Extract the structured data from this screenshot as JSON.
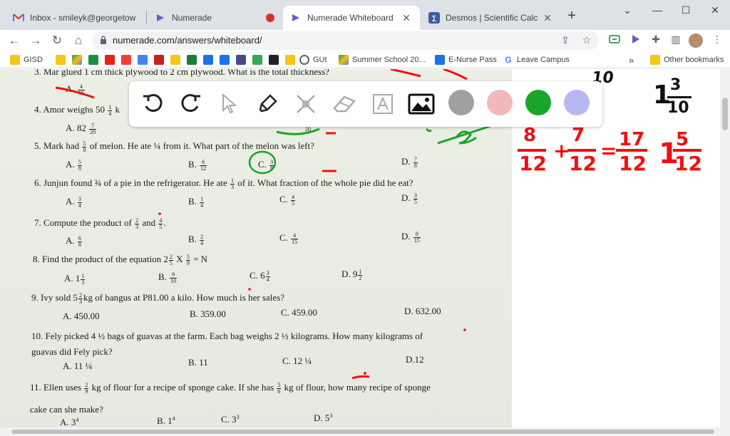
{
  "tabs": [
    {
      "title": "Inbox - smileyk@georgetow",
      "icon": "gmail-icon",
      "active": false
    },
    {
      "title": "Numerade",
      "icon": "numerade-icon",
      "active": false
    },
    {
      "title": "Numerade Whiteboard",
      "icon": "numerade-icon",
      "active": true
    },
    {
      "title": "Desmos | Scientific Calculat",
      "icon": "desmos-icon",
      "active": false
    }
  ],
  "address": {
    "url": "numerade.com/answers/whiteboard/"
  },
  "bookmarks": [
    {
      "label": "GISD",
      "icon": "folder-icon"
    },
    {
      "label": "GUt",
      "icon": "globe-icon"
    },
    {
      "label": "Summer School 20...",
      "icon": "drive-icon"
    },
    {
      "label": "E-Nurse Pass",
      "icon": "bookmark-icon"
    },
    {
      "label": "Leave Campus",
      "icon": "google-icon"
    },
    {
      "label": "Other bookmarks",
      "icon": "folder-icon"
    }
  ],
  "overflow_label": "»",
  "worksheet": {
    "q3": {
      "pre": "3. Mar glued 1",
      "mid": "cm thick plywood to 2",
      "post": "cm plywood. What is the total thickness?",
      "optA": "A.",
      "optA_n": "4",
      "optA_d": "16"
    },
    "q4": {
      "pre": "4. Amor weighs 50",
      "f_n": "1",
      "f_d": "4",
      "post": "k",
      "optA": "A.  82",
      "optA_n": "7",
      "optA_d": "20",
      "optC_d": "20"
    },
    "q5": {
      "pre": "5. Mark had",
      "f_n": "5",
      "f_d": "8",
      "post": "of melon. He ate ¼ from it. What part of the melon was left?",
      "a": "A.",
      "a_n": "5",
      "a_d": "8",
      "b": "B.",
      "b_n": "6",
      "b_d": "12",
      "c": "C.",
      "c_n": "3",
      "c_d": "8",
      "d": "D.",
      "d_n": "7",
      "d_d": "8"
    },
    "q6": {
      "pre": "6. Junjun found ¾ of a pie in the refrigerator. He ate",
      "f_n": "1",
      "f_d": "3",
      "post": "of it. What fraction of the whole pie did he eat?",
      "a": "A.",
      "a_n": "3",
      "a_d": "4",
      "b": "B.",
      "b_n": "1",
      "b_d": "4",
      "c": "C.",
      "c_n": "4",
      "c_d": "5",
      "d": "D.",
      "d_n": "3",
      "d_d": "5"
    },
    "q7": {
      "pre": "7. Compute the product of",
      "f1_n": "2",
      "f1_d": "3",
      "and": "and",
      "f2_n": "4",
      "f2_d": "5",
      "dot": ".",
      "a": "A.",
      "a_n": "6",
      "a_d": "8",
      "b": "B.",
      "b_n": "2",
      "b_d": "4",
      "c": "C.",
      "c_n": "4",
      "c_d": "15",
      "d": "D.",
      "d_n": "8",
      "d_d": "15"
    },
    "q8": {
      "pre": "8. Find the product of the equation 2",
      "f1_n": "2",
      "f1_d": "5",
      "x": "X",
      "f2_n": "5",
      "f2_d": "9",
      "post": "= N",
      "a": "A. 1",
      "a_n": "1",
      "a_d": "3",
      "b": "B.",
      "b_n": "9",
      "b_d": "10",
      "c": "C. 6",
      "c_n": "3",
      "c_d": "4",
      "d": "D. 9",
      "d_n": "1",
      "d_d": "2"
    },
    "q9": {
      "pre": "9. Ivy sold 5",
      "f_n": "2",
      "f_d": "3",
      "post": "kg of bangus at P81.00 a kilo. How much is her sales?",
      "a": "A. 450.00",
      "b": "B. 359.00",
      "c": "C. 459.00",
      "d": "D. 632.00"
    },
    "q10": {
      "line1": "10. Fely picked 4 ½ bags of guavas at the farm. Each bag    weighs 2 ½ kilograms. How many kilograms of",
      "line2": "guavas did Fely pick?",
      "a": "A. 11 ¼",
      "b": "B. 11",
      "c": "C. 12 ¼",
      "d": "D.12"
    },
    "q11": {
      "pre": "11. Ellen uses",
      "f1_n": "2",
      "f1_d": "9",
      "mid": "kg of flour for a recipe of sponge cake. If she has",
      "f2_n": "5",
      "f2_d": "6",
      "post": "kg of flour, how many recipe of sponge",
      "line2": "cake can she make?",
      "a": "A. 3",
      "a_n": "4",
      "b": "B. 1",
      "b_n": "4",
      "c": "C. 3",
      "c_n": "3",
      "d": "D. 5",
      "d_n": "3"
    }
  },
  "whiteboard": {
    "tools": [
      "undo-icon",
      "redo-icon",
      "pointer-icon",
      "pen-icon",
      "laser-icon",
      "eraser-icon",
      "text-icon",
      "image-icon"
    ],
    "colors": [
      "#a0a0a0",
      "#f2b8b8",
      "#1aa52a",
      "#b8b8f0"
    ],
    "handwriting": {
      "top_right": "10",
      "mixed1": "1 3/10",
      "eq_lhs1": "8/12",
      "plus": "+",
      "eq_lhs2": "7/12",
      "eq": "=",
      "eq_rhs": "17/12",
      "mixed2": "1 5/12"
    }
  }
}
